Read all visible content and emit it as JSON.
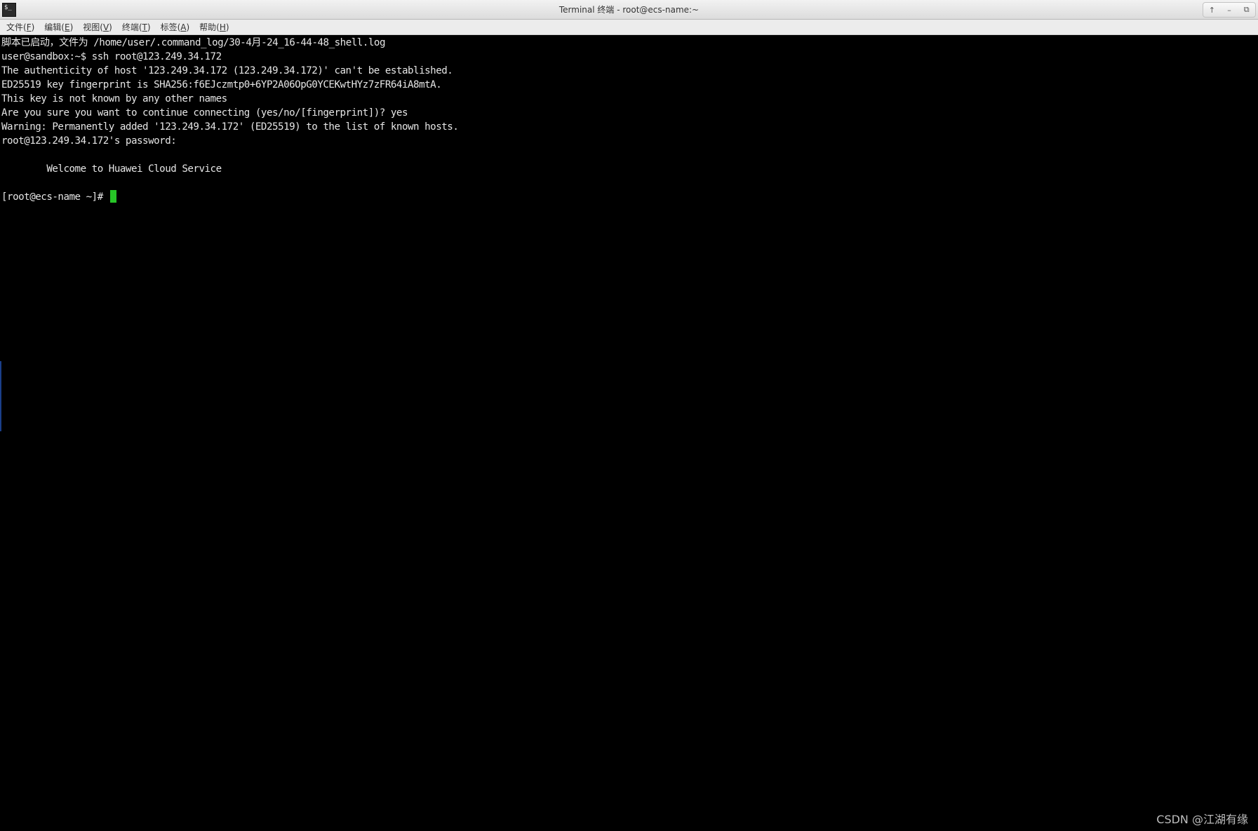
{
  "window": {
    "title": "Terminal 终端 - root@ecs-name:~",
    "icon": "terminal-icon",
    "controls": [
      {
        "name": "up-icon",
        "glyph": "↑"
      },
      {
        "name": "minimize-icon",
        "glyph": "–"
      },
      {
        "name": "restore-icon",
        "glyph": "⧉"
      }
    ]
  },
  "menubar": {
    "items": [
      {
        "label": "文件(",
        "mnemonic": "F",
        "suffix": ")"
      },
      {
        "label": "编辑(",
        "mnemonic": "E",
        "suffix": ")"
      },
      {
        "label": "视图(",
        "mnemonic": "V",
        "suffix": ")"
      },
      {
        "label": "终端(",
        "mnemonic": "T",
        "suffix": ")"
      },
      {
        "label": "标签(",
        "mnemonic": "A",
        "suffix": ")"
      },
      {
        "label": "帮助(",
        "mnemonic": "H",
        "suffix": ")"
      }
    ]
  },
  "terminal": {
    "lines": [
      "脚本已启动，文件为 /home/user/.command_log/30-4月-24_16-44-48_shell.log",
      "user@sandbox:~$ ssh root@123.249.34.172",
      "The authenticity of host '123.249.34.172 (123.249.34.172)' can't be established.",
      "ED25519 key fingerprint is SHA256:f6EJczmtp0+6YP2A06OpG0YCEKwtHYz7zFR64iA8mtA.",
      "This key is not known by any other names",
      "Are you sure you want to continue connecting (yes/no/[fingerprint])? yes",
      "Warning: Permanently added '123.249.34.172' (ED25519) to the list of known hosts.",
      "root@123.249.34.172's password:",
      "",
      "        Welcome to Huawei Cloud Service",
      ""
    ],
    "prompt": "[root@ecs-name ~]# ",
    "cursor_color": "#27c527",
    "foreground": "#e6e6e6",
    "background": "#000000"
  },
  "watermark": "CSDN @江湖有缘"
}
